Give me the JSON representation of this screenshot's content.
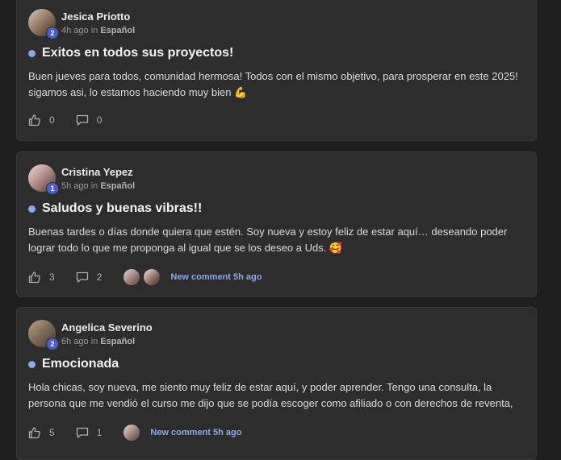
{
  "posts": [
    {
      "author": "Jesica Priotto",
      "level": "2",
      "time": "4h ago",
      "in_label": "in",
      "category": "Español",
      "title": "Exitos en todos sus proyectos!",
      "body": "Buen jueves para todos, comunidad hermosa! Todos con el mismo objetivo, para prosperar en este 2025! sigamos asi, lo estamos haciendo muy bien 💪",
      "likes": "0",
      "comments": "0",
      "new_comment": ""
    },
    {
      "author": "Cristina Yepez",
      "level": "1",
      "time": "5h ago",
      "in_label": "in",
      "category": "Español",
      "title": "Saludos y buenas vibras!!",
      "body": "Buenas tardes o días donde quiera que estén. Soy nueva y estoy feliz de estar aquí… deseando poder lograr todo lo que me proponga al igual que se los deseo a Uds. 🥰",
      "likes": "3",
      "comments": "2",
      "new_comment": "New comment 5h ago"
    },
    {
      "author": "Angelica Severino",
      "level": "2",
      "time": "6h ago",
      "in_label": "in",
      "category": "Español",
      "title": "Emocionada",
      "body": "Hola chicas, soy nueva, me siento muy feliz de estar aquí, y poder aprender. Tengo una consulta, la persona que me vendió el curso me dijo que se podía escoger como afiliado o con derechos de reventa,",
      "likes": "5",
      "comments": "1",
      "new_comment": "New comment 5h ago"
    }
  ],
  "icons": {
    "like": "thumbs-up-icon",
    "comment": "comment-bubble-icon"
  },
  "colors": {
    "background": "#1f1f1f",
    "card": "#2d2d2d",
    "accent": "#8ea6ef",
    "level_badge": "#4d5bd1"
  }
}
